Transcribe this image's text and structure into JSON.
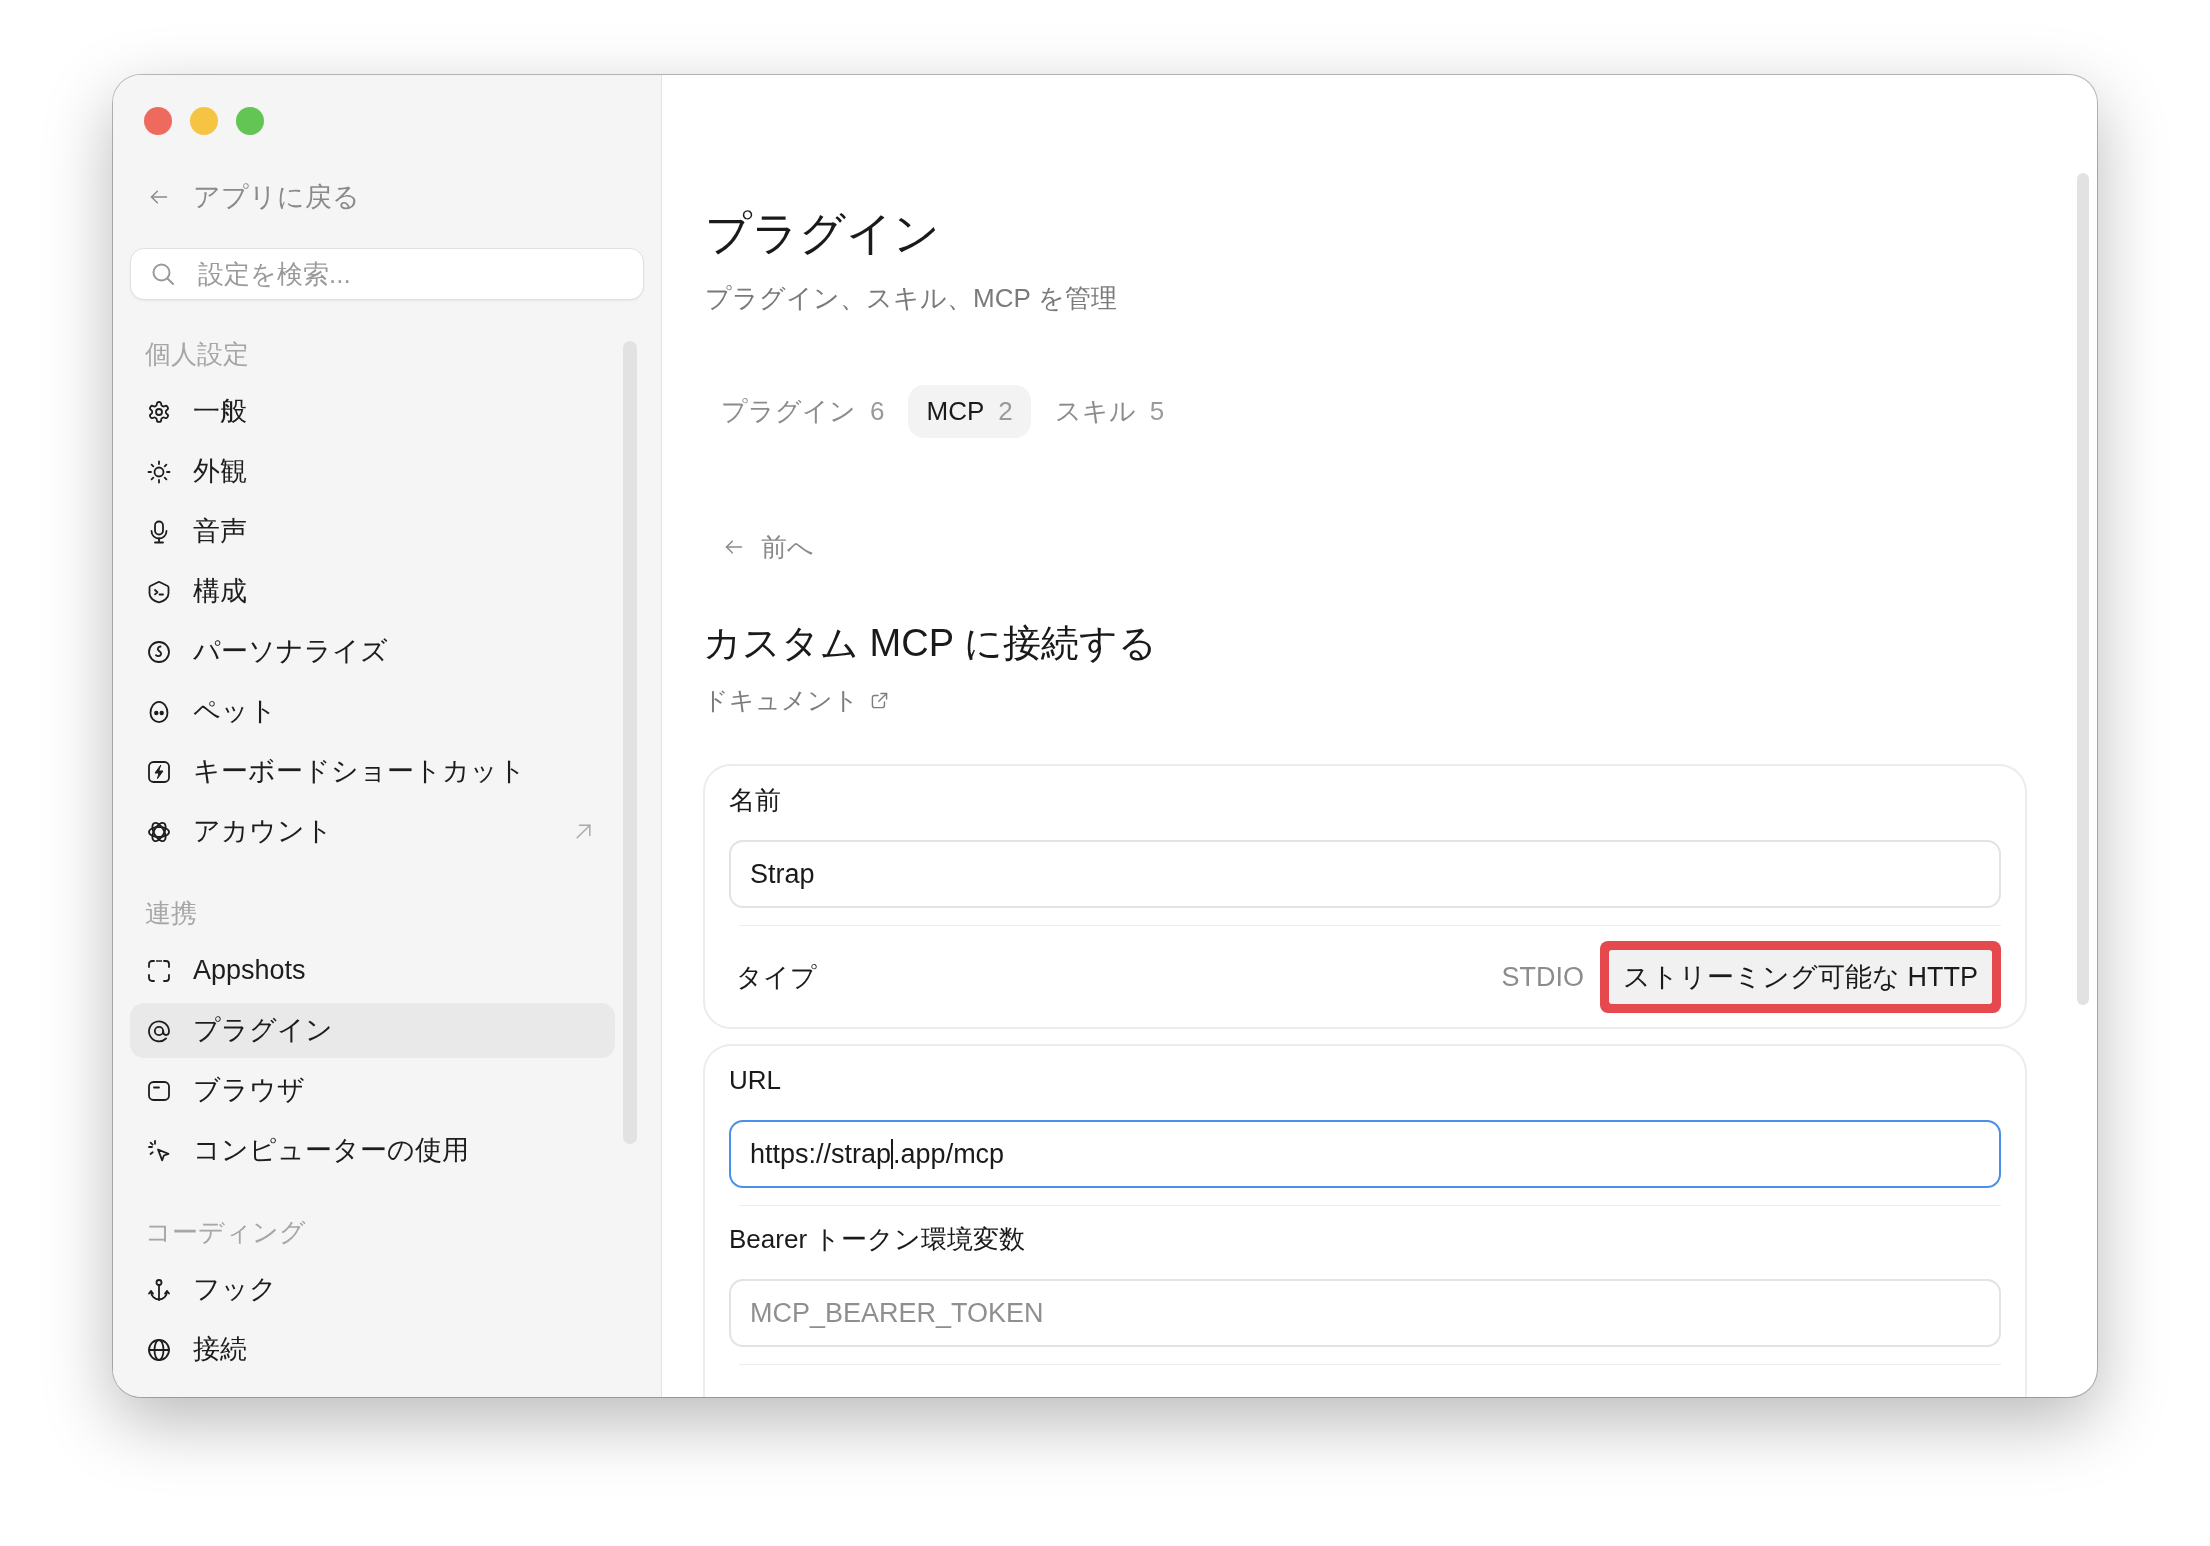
{
  "window": {
    "controls": [
      {
        "color": "#ee6a5f"
      },
      {
        "color": "#f5c443"
      },
      {
        "color": "#62c554"
      }
    ]
  },
  "sidebar": {
    "back_link": {
      "label": "アプリに戻る"
    },
    "search": {
      "placeholder": "設定を検索..."
    },
    "sections": [
      {
        "title": "個人設定",
        "items": [
          {
            "label": "一般",
            "selected": false,
            "external": false
          },
          {
            "label": "外観",
            "selected": false,
            "external": false
          },
          {
            "label": "音声",
            "selected": false,
            "external": false
          },
          {
            "label": "構成",
            "selected": false,
            "external": false
          },
          {
            "label": "パーソナライズ",
            "selected": false,
            "external": false
          },
          {
            "label": "ペット",
            "selected": false,
            "external": false
          },
          {
            "label": "キーボードショートカット",
            "selected": false,
            "external": false
          },
          {
            "label": "アカウント",
            "selected": false,
            "external": true
          }
        ]
      },
      {
        "title": "連携",
        "items": [
          {
            "label": "Appshots",
            "selected": false,
            "external": false
          },
          {
            "label": "プラグイン",
            "selected": true,
            "external": false
          },
          {
            "label": "ブラウザ",
            "selected": false,
            "external": false
          },
          {
            "label": "コンピューターの使用",
            "selected": false,
            "external": false
          }
        ]
      },
      {
        "title": "コーディング",
        "items": [
          {
            "label": "フック",
            "selected": false,
            "external": false
          },
          {
            "label": "接続",
            "selected": false,
            "external": false
          }
        ]
      }
    ]
  },
  "main": {
    "title": "プラグイン",
    "subtitle": "プラグイン、スキル、MCP を管理",
    "tabs": [
      {
        "label": "プラグイン",
        "count": "6",
        "selected": false
      },
      {
        "label": "MCP",
        "count": "2",
        "selected": true
      },
      {
        "label": "スキル",
        "count": "5",
        "selected": false
      }
    ],
    "back_button": {
      "label": "前へ"
    },
    "form": {
      "title": "カスタム MCP に接続する",
      "docs_link": {
        "label": "ドキュメント"
      },
      "cards": [
        {
          "continues": false,
          "fields": [
            {
              "kind": "input",
              "label": "名前",
              "value": "Strap",
              "focused": false
            },
            {
              "kind": "choice",
              "label": "タイプ",
              "options": [
                {
                  "label": "STDIO",
                  "selected": false,
                  "highlighted": false
                },
                {
                  "label": "ストリーミング可能な HTTP",
                  "selected": true,
                  "highlighted": true
                }
              ]
            }
          ]
        },
        {
          "continues": true,
          "fields": [
            {
              "kind": "input",
              "label": "URL",
              "value": "https://strap",
              "value_after_caret": ".app/mcp",
              "focused": true
            },
            {
              "kind": "input",
              "label": "Bearer トークン環境変数",
              "placeholder": "MCP_BEARER_TOKEN",
              "focused": false
            }
          ]
        }
      ]
    }
  }
}
